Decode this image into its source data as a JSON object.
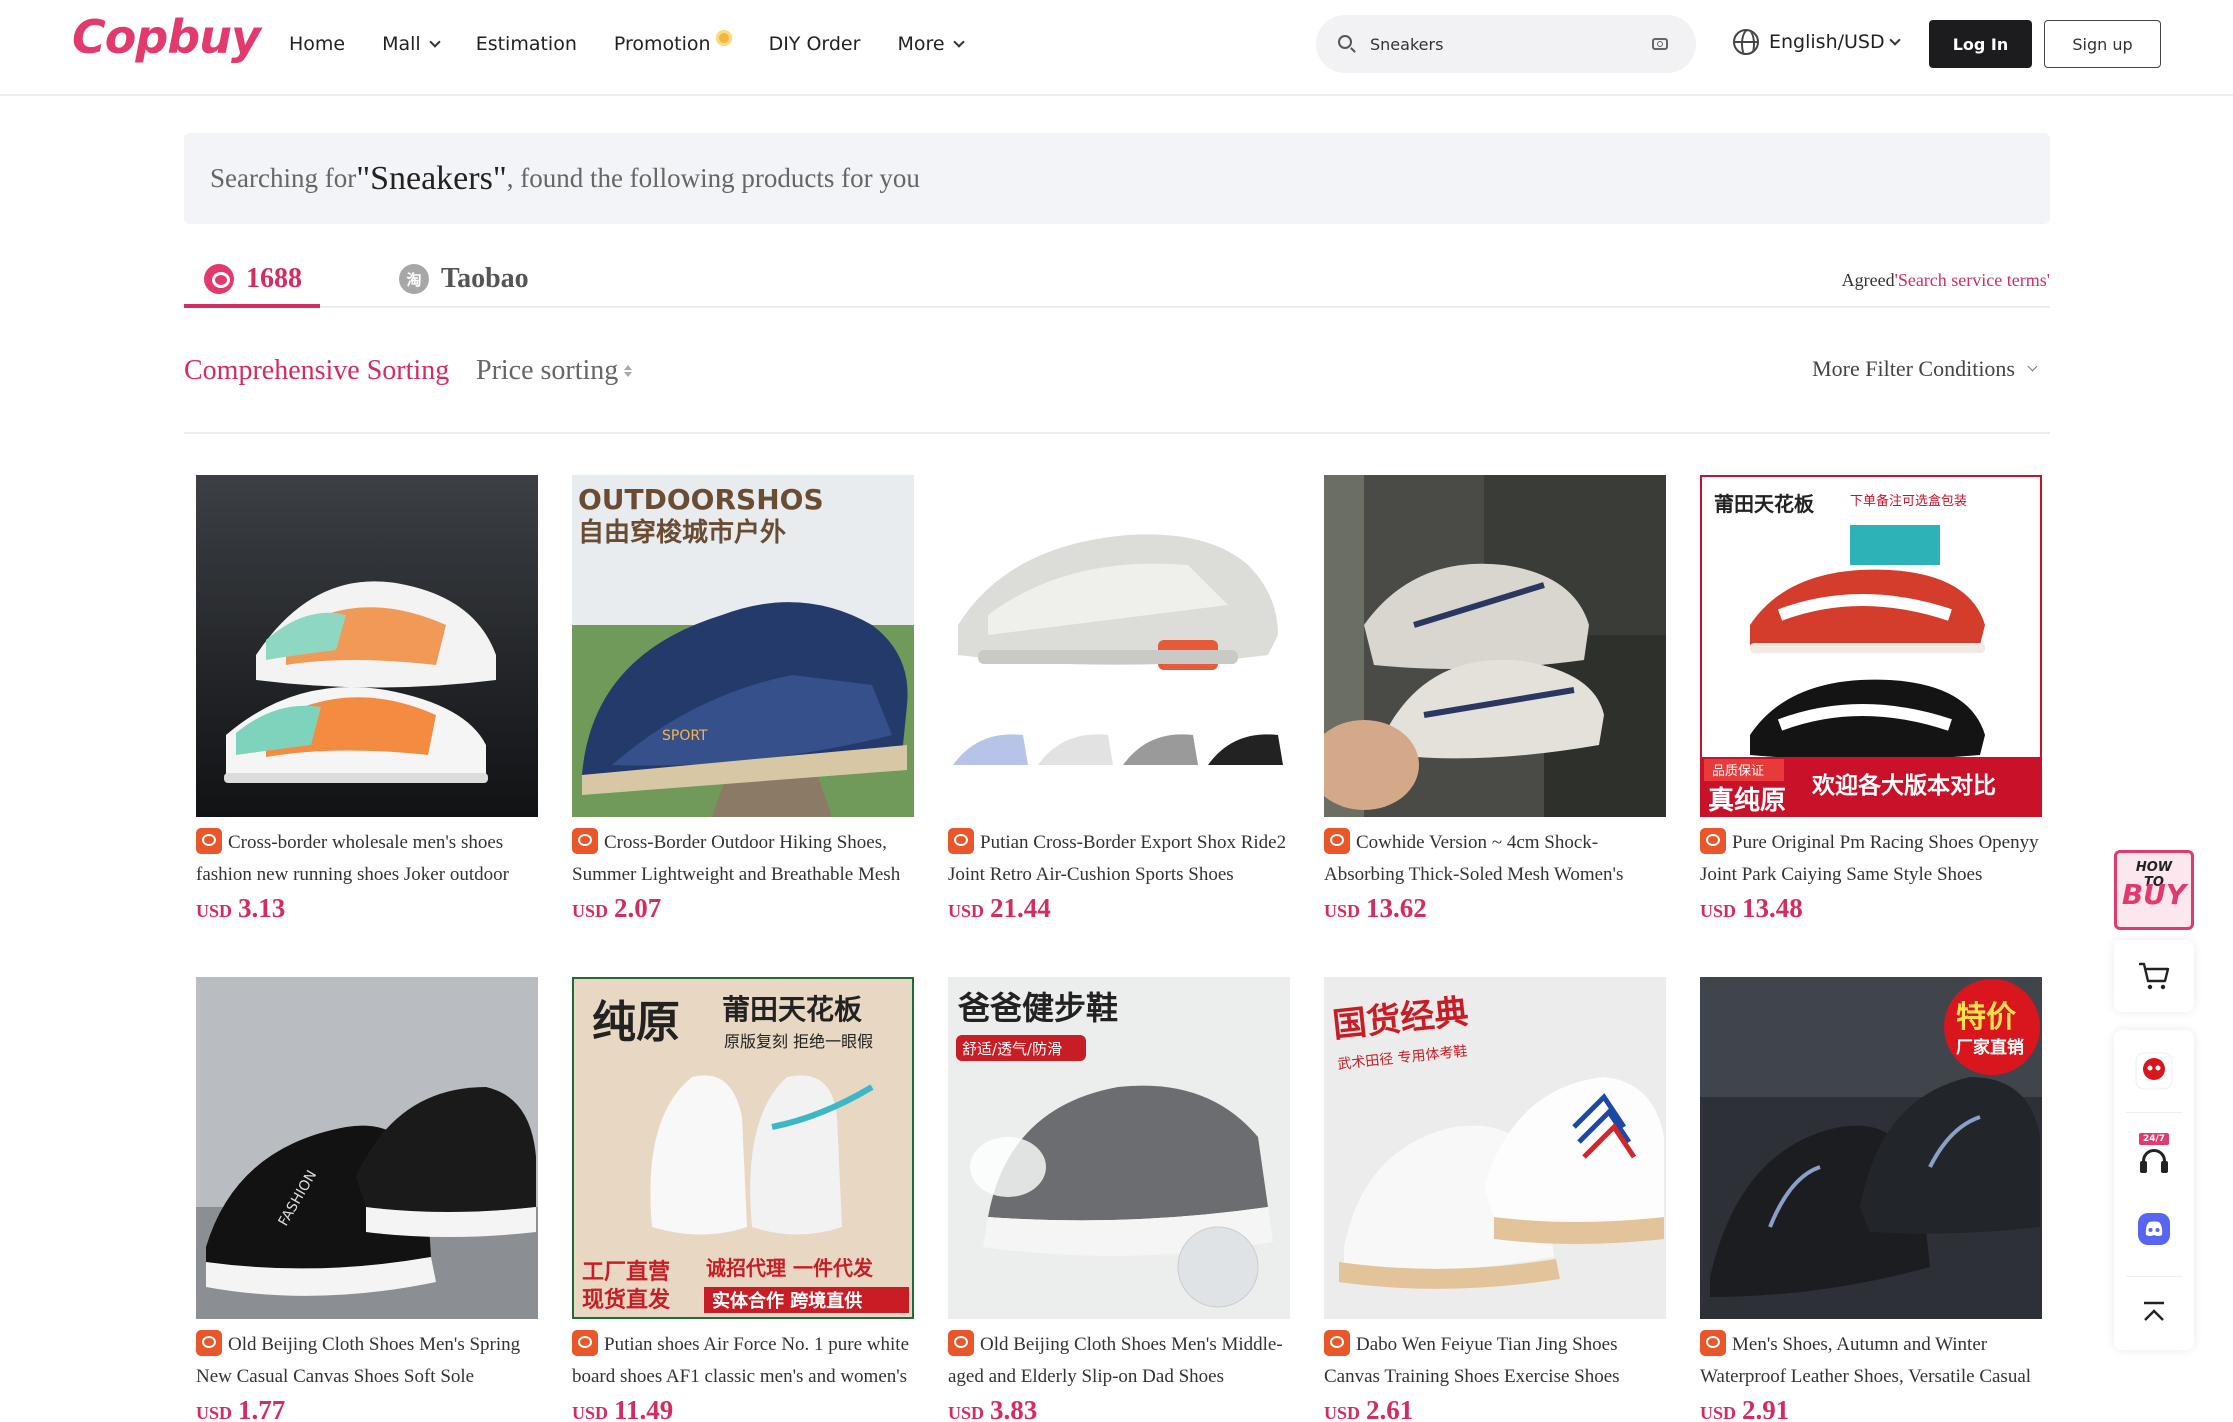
{
  "header": {
    "logo": "Copbuy",
    "nav": [
      {
        "label": "Home",
        "dropdown": false,
        "badge": false
      },
      {
        "label": "Mall",
        "dropdown": true,
        "badge": false
      },
      {
        "label": "Estimation",
        "dropdown": false,
        "badge": false
      },
      {
        "label": "Promotion",
        "dropdown": false,
        "badge": true
      },
      {
        "label": "DIY Order",
        "dropdown": false,
        "badge": false
      },
      {
        "label": "More",
        "dropdown": true,
        "badge": false
      }
    ],
    "search": {
      "value": "Sneakers",
      "placeholder": "Sneakers"
    },
    "language": "English/USD",
    "login_label": "Log In",
    "signup_label": "Sign up"
  },
  "banner": {
    "prefix": "Searching for",
    "keyword": "\"Sneakers\"",
    "suffix": ", found the following products for you"
  },
  "source_tabs": {
    "tabs": [
      {
        "label": "1688",
        "active": true
      },
      {
        "label": "Taobao",
        "active": false
      }
    ],
    "terms_prefix": "Agreed",
    "terms_link": "'Search service terms'"
  },
  "sorting": {
    "comprehensive": "Comprehensive Sorting",
    "price": "Price sorting",
    "more_filters": "More Filter Conditions"
  },
  "products": [
    {
      "title": "Cross-border wholesale men's shoes fashion new running shoes Joker outdoor sneakers",
      "currency": "USD",
      "price": "3.13"
    },
    {
      "title": "Cross-Border Outdoor Hiking Shoes, Summer Lightweight and Breathable Mesh Shoes",
      "currency": "USD",
      "price": "2.07"
    },
    {
      "title": "Putian Cross-Border Export Shox Ride2 Joint Retro Air-Cushion Sports Shoes",
      "currency": "USD",
      "price": "21.44"
    },
    {
      "title": "Cowhide Version ~ 4cm Shock-Absorbing Thick-Soled Mesh Women's Sneakers",
      "currency": "USD",
      "price": "13.62"
    },
    {
      "title": "Pure Original Pm Racing Shoes Openyy Joint Park Caiying Same Style Shoes",
      "currency": "USD",
      "price": "13.48"
    },
    {
      "title": "Old Beijing Cloth Shoes Men's Spring New Casual Canvas Shoes Soft Sole",
      "currency": "USD",
      "price": "1.77"
    },
    {
      "title": "Putian shoes Air Force No. 1 pure white board shoes AF1 classic men's and women's",
      "currency": "USD",
      "price": "11.49"
    },
    {
      "title": "Old Beijing Cloth Shoes Men's Middle-aged and Elderly Slip-on Dad Shoes",
      "currency": "USD",
      "price": "3.83"
    },
    {
      "title": "Dabo Wen Feiyue Tian Jing Shoes Canvas Training Shoes Exercise Shoes Martial Arts",
      "currency": "USD",
      "price": "2.61"
    },
    {
      "title": "Men's Shoes, Autumn and Winter Waterproof Leather Shoes, Versatile Casual Sneakers",
      "currency": "USD",
      "price": "2.91"
    }
  ],
  "image_text": {
    "p2_top": "OUTDOORSHOS",
    "p2_cn": "自由穿梭城市户外",
    "p2_tag": "SPORT",
    "p5_cn1": "莆田天花板",
    "p5_cn2": "下单备注可选盒包装",
    "p5_cn3": "品质保证",
    "p5_cn4": "真纯原",
    "p5_cn5": "欢迎各大版本对比",
    "p6_tag": "FASHION",
    "p7_cn1": "纯原",
    "p7_cn2": "莆田天花板",
    "p7_cn3": "原版复刻 拒绝一眼假",
    "p7_cn4": "工厂直营",
    "p7_cn5": "现货直发",
    "p7_cn6": "诚招代理 一件代发",
    "p7_cn7": "实体合作 跨境直供",
    "p8_cn1": "爸爸健步鞋",
    "p8_cn2": "舒适/透气/防滑",
    "p9_cn1": "国货经典",
    "p9_cn2": "武术田径 专用体考鞋",
    "p10_cn1": "特价",
    "p10_cn2": "厂家直销"
  },
  "sidebar": {
    "howto_top": "HOW TO",
    "howto_buy": "BUY",
    "support_badge": "24/7"
  },
  "colors": {
    "brand": "#e23a6d",
    "price": "#d62b5e",
    "dark_button": "#1c1c1e"
  }
}
